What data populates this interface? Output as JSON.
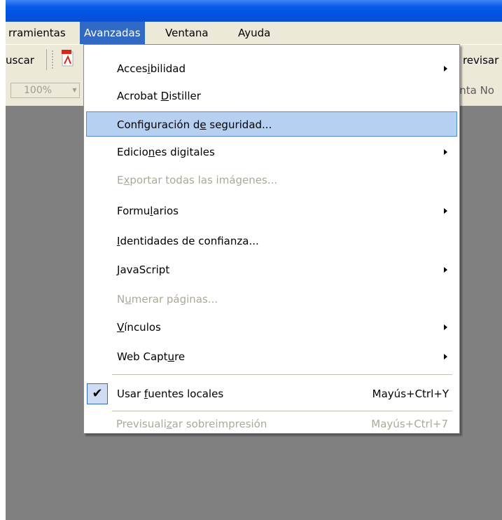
{
  "menubar": {
    "items": [
      {
        "label": "rramientas"
      },
      {
        "label": "Avanzadas"
      },
      {
        "label": "Ventana"
      },
      {
        "label": "Ayuda"
      }
    ]
  },
  "toolbar": {
    "search_label": "uscar",
    "right_label": "a revisar",
    "zoom_value": "100%",
    "right_label_2": "enta No"
  },
  "dropdown": {
    "items": [
      {
        "label_pre": "Acces",
        "label_u": "i",
        "label_post": "bilidad",
        "submenu": true
      },
      {
        "label_pre": "Acrobat ",
        "label_u": "D",
        "label_post": "istiller"
      },
      {
        "label_pre": "Configuración d",
        "label_u": "e",
        "label_post": " seguridad...",
        "highlighted": true
      },
      {
        "label_pre": "Edicio",
        "label_u": "n",
        "label_post": "es digitales",
        "submenu": true
      },
      {
        "label_pre": "E",
        "label_u": "x",
        "label_post": "portar todas las imágenes...",
        "disabled": true
      },
      {
        "label_pre": "Formu",
        "label_u": "l",
        "label_post": "arios",
        "submenu": true
      },
      {
        "label_pre": "",
        "label_u": "I",
        "label_post": "dentidades de confianza..."
      },
      {
        "label_pre": "",
        "label_u": "J",
        "label_post": "avaScript",
        "submenu": true
      },
      {
        "label_pre": "N",
        "label_u": "u",
        "label_post": "merar páginas...",
        "disabled": true
      },
      {
        "label_pre": "",
        "label_u": "V",
        "label_post": "ínculos",
        "submenu": true
      },
      {
        "label_pre": "Web Capt",
        "label_u": "u",
        "label_post": "re",
        "submenu": true
      }
    ],
    "local_fonts": {
      "label_pre": "Usar ",
      "label_u": "f",
      "label_post": "uentes locales",
      "shortcut": "Mayús+Ctrl+Y",
      "checked": true,
      "check_glyph": "✔"
    },
    "overprint": {
      "label_pre": "Previsuali",
      "label_u": "z",
      "label_post": "ar sobreimpresión",
      "shortcut": "Mayús+Ctrl+7",
      "disabled": true
    }
  },
  "colors": {
    "title_bar": "#0054e3",
    "menu_highlight": "#316ac5",
    "item_highlight": "#b6d0f2",
    "workspace": "#808080"
  }
}
